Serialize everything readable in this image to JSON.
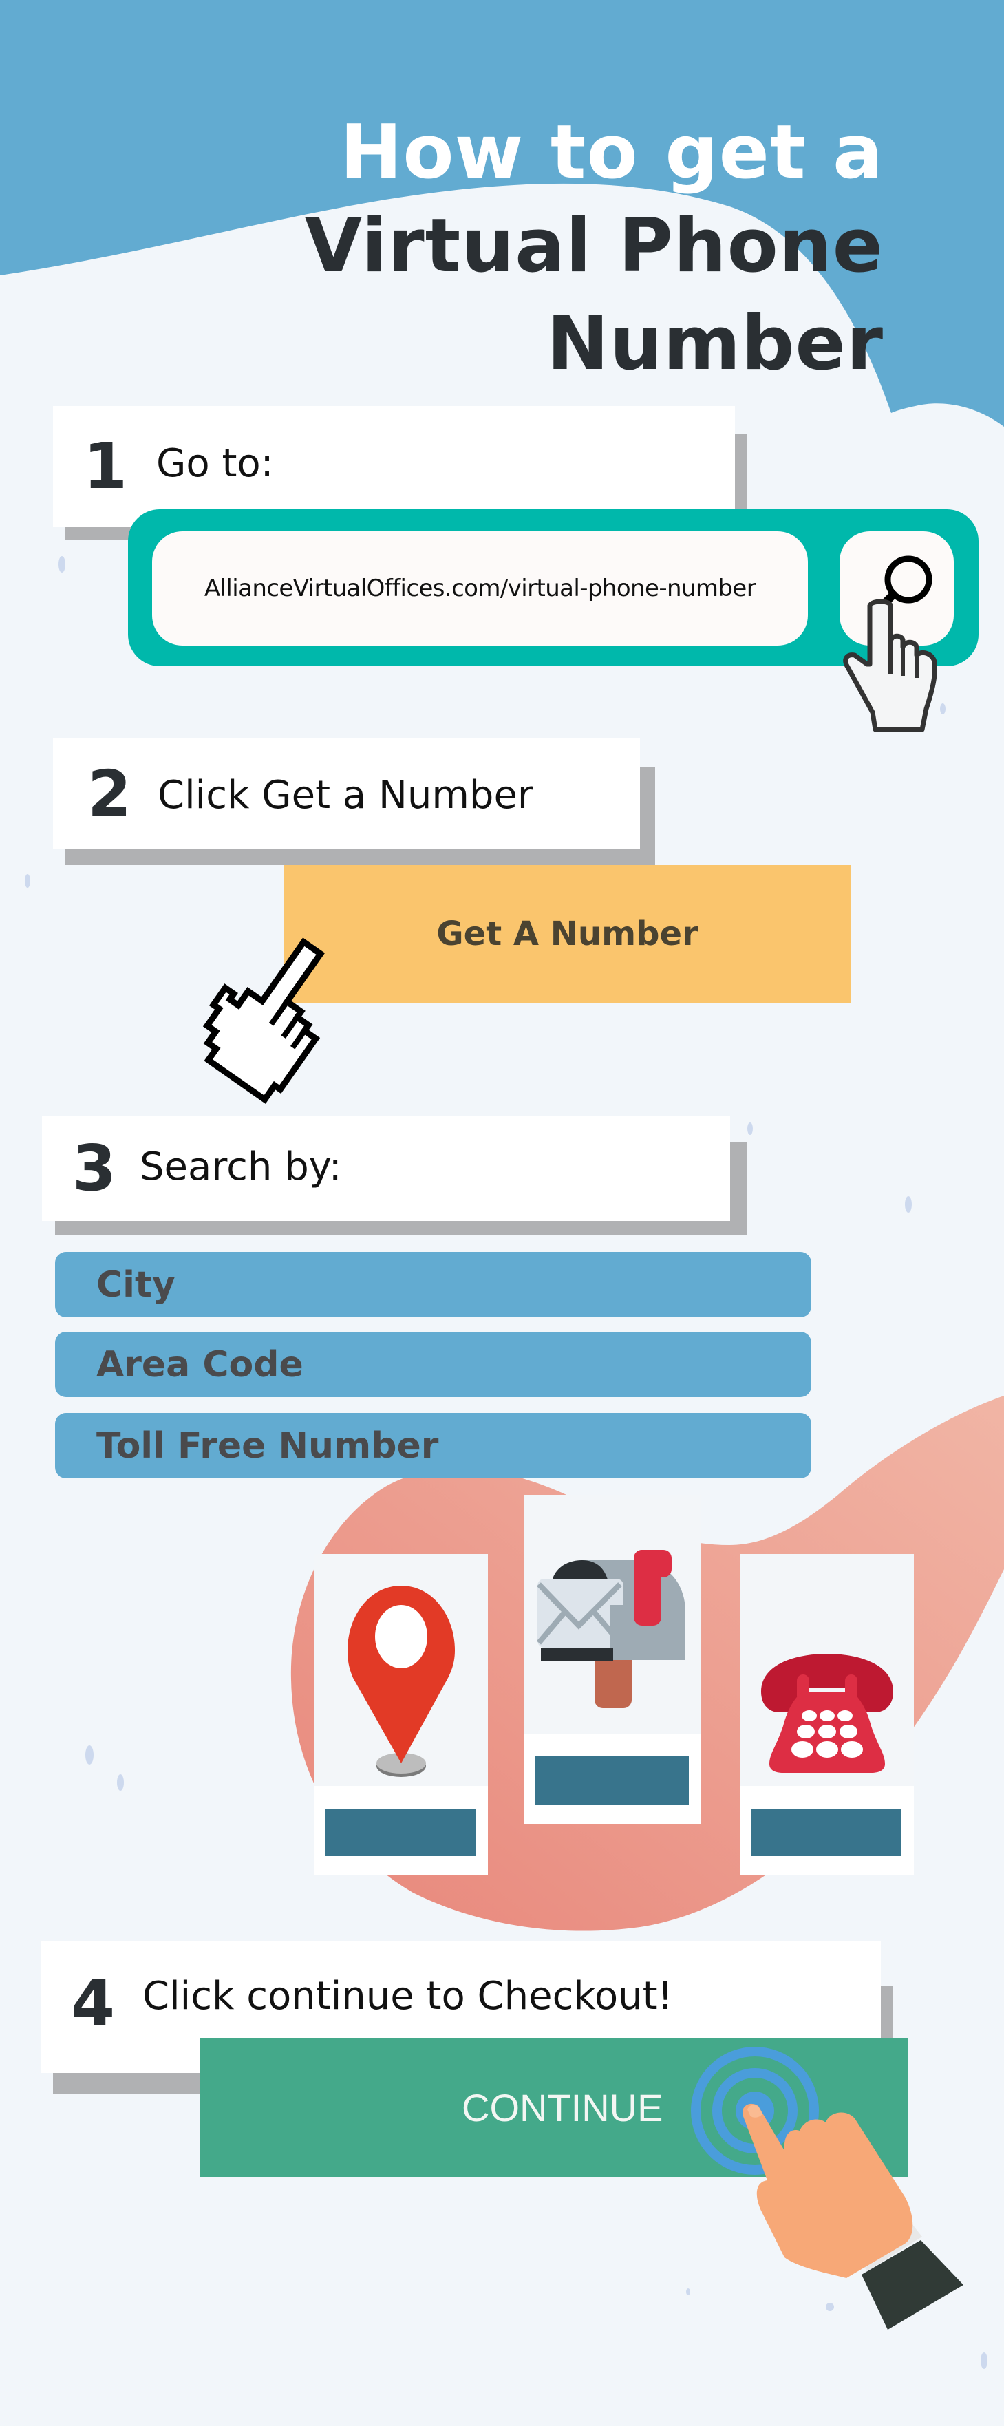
{
  "header": {
    "title_line1": "How to get a",
    "title_line2": "Virtual Phone",
    "title_line3": "Number"
  },
  "colors": {
    "header_blue": "#62abd1",
    "background": "#f2f6fa",
    "teal": "#00b8ab",
    "yellow": "#fac56d",
    "green": "#44a98a",
    "pink": "#ec8f82",
    "dark_text": "#2a2f33"
  },
  "steps": [
    {
      "number": "1",
      "label": "Go to:",
      "url": "AllianceVirtualOffices.com/virtual-phone-number",
      "icon": "search-icon"
    },
    {
      "number": "2",
      "label_prefix": "Click ",
      "label_emph": "Get a Number",
      "button_label": "Get A Number",
      "icon": "pixel-pointer-hand-icon"
    },
    {
      "number": "3",
      "label": "Search by:",
      "options": [
        "City",
        "Area Code",
        "Toll Free Number"
      ],
      "cards": [
        {
          "icon": "location-pin-icon"
        },
        {
          "icon": "mailbox-icon"
        },
        {
          "icon": "telephone-icon"
        }
      ]
    },
    {
      "number": "4",
      "label": "Click continue to Checkout!",
      "button_label": "CONTINUE",
      "icon": "pointing-hand-icon"
    }
  ]
}
